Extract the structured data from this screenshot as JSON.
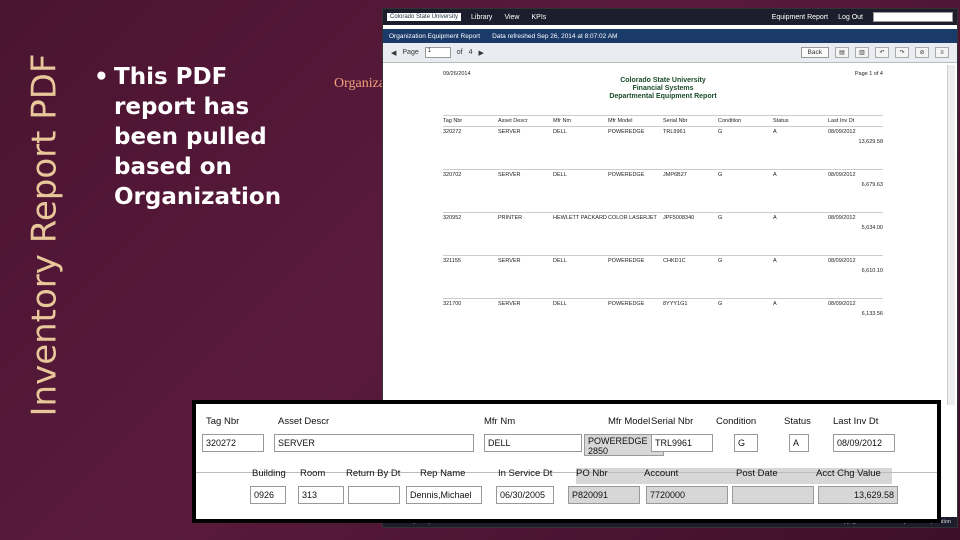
{
  "slide": {
    "vertical_title": "Inventory Report PDF",
    "bullet": "This PDF report has been pulled based on Organization",
    "annotation": "Organization code"
  },
  "screenshot": {
    "topbar": {
      "logo": "Colorado State University",
      "nav": [
        "Library",
        "View",
        "KPIs"
      ],
      "right": [
        "Equipment Report",
        "Log Out"
      ]
    },
    "report_title": "Organization Equipment Report",
    "refreshed": "Data refreshed Sep 26, 2014 at 8:07:02 AM",
    "toolbar": {
      "page_label": "Page",
      "page_value": "1",
      "of_label": "of",
      "of_value": "4",
      "back": "Back"
    },
    "pdf": {
      "date": "09/26/2014",
      "page": "Page 1 of 4",
      "university": "Colorado State University",
      "dept": "Financial Systems",
      "report": "Departmental Equipment Report",
      "header": [
        "Tag Nbr",
        "Asset Descr",
        "Mfr Nm",
        "Mfr Model",
        "Serial Nbr",
        "Condition",
        "Status",
        "Last Inv Dt"
      ],
      "rows": [
        {
          "tag": "320272",
          "desc": "SERVER",
          "mfr": "DELL",
          "model": "POWEREDGE",
          "serial": "TRL9961",
          "cond": "G",
          "status": "A",
          "inv": "08/09/2012",
          "total": "13,629.58"
        },
        {
          "tag": "320702",
          "desc": "SERVER",
          "mfr": "DELL",
          "model": "POWEREDGE",
          "serial": "JMP6B27",
          "cond": "G",
          "status": "A",
          "inv": "08/09/2012",
          "total": "6,679.63"
        },
        {
          "tag": "320952",
          "desc": "PRINTER",
          "mfr": "HEWLETT PACKARD",
          "model": "COLOR LASERJET",
          "serial": "JPF5008340",
          "cond": "G",
          "status": "A",
          "inv": "08/09/2012",
          "total": "5,634.00"
        },
        {
          "tag": "321155",
          "desc": "SERVER",
          "mfr": "DELL",
          "model": "POWEREDGE",
          "serial": "CHKD1C",
          "cond": "G",
          "status": "A",
          "inv": "08/09/2012",
          "total": "6,610.10"
        },
        {
          "tag": "321700",
          "desc": "SERVER",
          "mfr": "DELL",
          "model": "POWEREDGE",
          "serial": "8YYY1G1",
          "cond": "G",
          "status": "A",
          "inv": "08/09/2012",
          "total": "6,133.56"
        }
      ]
    },
    "footer": {
      "left": "About JasperReports Server",
      "right": "Copyright © 2005-2013 Jaspersoft Corporation"
    }
  },
  "zoom": {
    "h1": [
      "Tag Nbr",
      "Asset Descr",
      "Mfr Nm",
      "Mfr Model",
      "Serial Nbr",
      "Condition",
      "Status",
      "Last Inv Dt"
    ],
    "v1": [
      "320272",
      "SERVER",
      "DELL",
      "POWEREDGE 2850",
      "TRL9961",
      "G",
      "A",
      "08/09/2012"
    ],
    "h2": [
      "Building",
      "Room",
      "Return By Dt",
      "Rep Name",
      "In Service Dt",
      "PO Nbr",
      "Account",
      "Post Date",
      "Acct Chg Value"
    ],
    "v2": [
      "0926",
      "313",
      "",
      "Dennis,Michael",
      "06/30/2005",
      "P820091",
      "7720000",
      "",
      "13,629.58"
    ]
  }
}
